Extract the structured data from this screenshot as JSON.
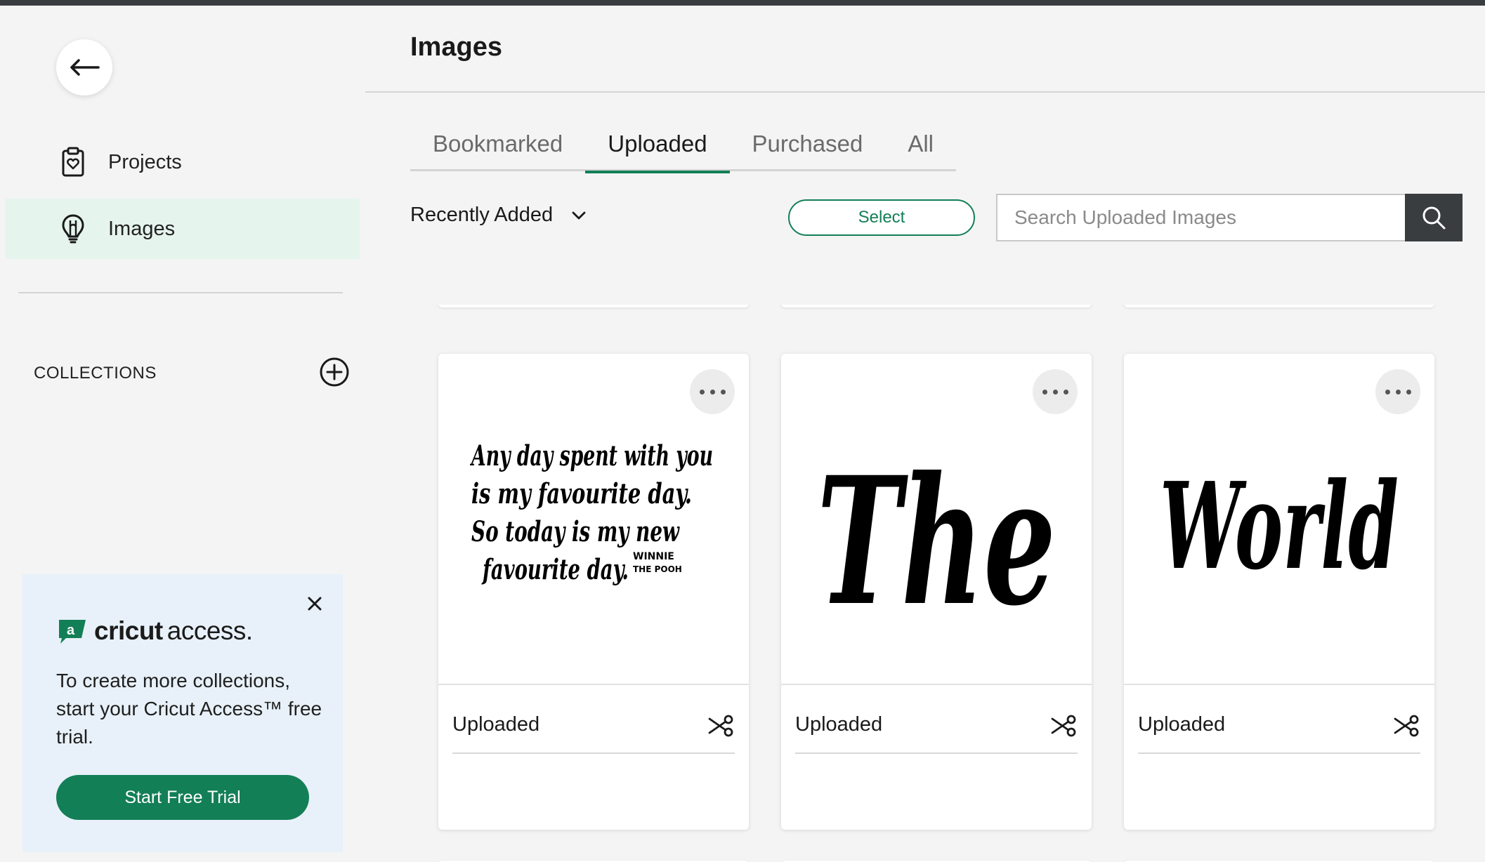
{
  "sidebar": {
    "nav": [
      {
        "label": "Projects",
        "icon": "clipboard-heart-icon"
      },
      {
        "label": "Images",
        "icon": "lightbulb-icon",
        "active": true
      }
    ],
    "collections_label": "COLLECTIONS",
    "promo": {
      "brand": "cricut",
      "access": "access.",
      "text": "To create more collections, start your Cricut Access™ free trial.",
      "cta": "Start Free Trial"
    }
  },
  "main": {
    "title": "Images",
    "tabs": [
      {
        "label": "Bookmarked",
        "active": false
      },
      {
        "label": "Uploaded",
        "active": true
      },
      {
        "label": "Purchased",
        "active": false
      },
      {
        "label": "All",
        "active": false
      }
    ],
    "sort_label": "Recently Added",
    "select_label": "Select",
    "search_placeholder": "Search Uploaded Images",
    "cards": [
      {
        "label": "Uploaded",
        "art": {
          "lines": [
            "Any day spent with you",
            "is my favourite day.",
            "So today is my new",
            "favourite day."
          ],
          "credit": [
            "WINNIE",
            "THE POOH"
          ]
        }
      },
      {
        "label": "Uploaded",
        "art": {
          "word": "The"
        }
      },
      {
        "label": "Uploaded",
        "art": {
          "word": "World"
        }
      }
    ]
  },
  "colors": {
    "accent": "#137f56",
    "dark": "#3a3d40",
    "active_bg": "#e6f4ee",
    "promo_bg": "#e8f1f9"
  }
}
